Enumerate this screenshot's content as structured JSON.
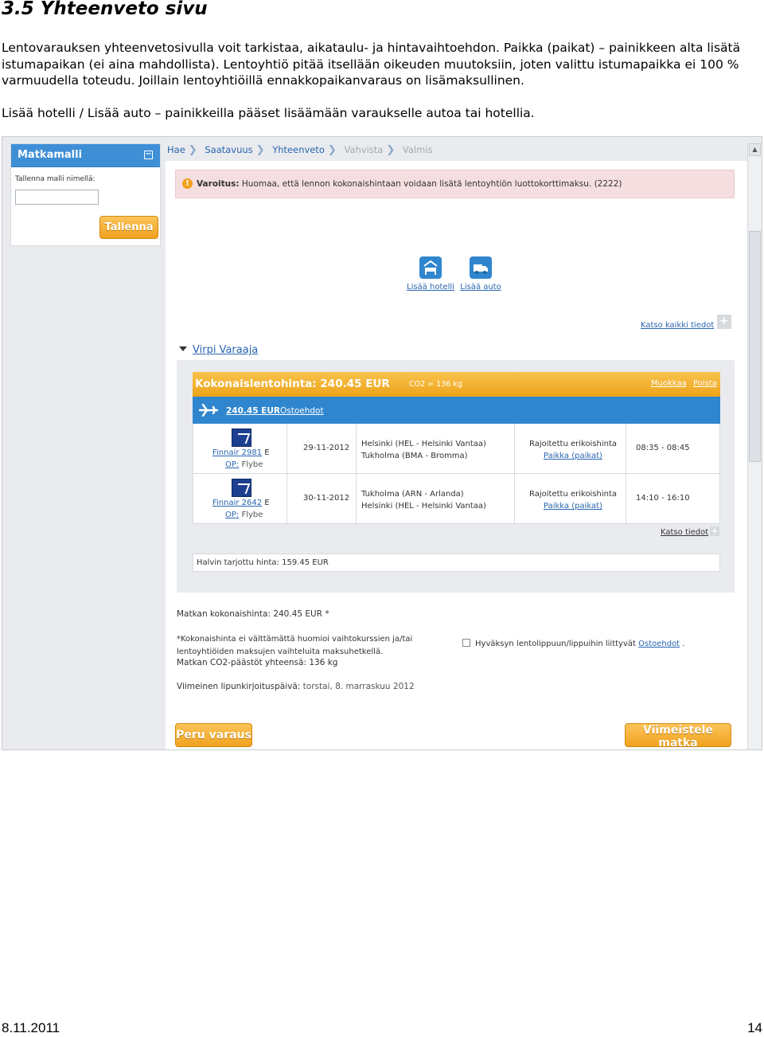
{
  "document": {
    "heading": "3.5 Yhteenveto sivu",
    "paragraph1": "Lentovarauksen yhteenvetosivulla voit tarkistaa, aikataulu- ja hintavaihtoehdon. Paikka (paikat) – painikkeen alta lisätä istumapaikan (ei aina mahdollista). Lentoyhtiö pitää itsellään oikeuden muutoksiin, joten valittu istumapaikka ei 100 % varmuudella toteudu. Joillain lentoyhtiöillä ennakkopaikanvaraus on lisämaksullinen.",
    "paragraph2": "Lisää hotelli / Lisää auto – painikkeilla pääset lisäämään varaukselle autoa tai hotellia.",
    "footer_date": "8.11.2011",
    "footer_page": "14"
  },
  "screenshot": {
    "sidebar": {
      "title": "Matkamalli",
      "minimize_symbol": "−",
      "label": "Tallenna malli nimellä:",
      "input_value": "",
      "save_label": "Tallenna"
    },
    "breadcrumb": {
      "step1": "Hae",
      "step2": "Saatavuus",
      "step3": "Yhteenveto",
      "step4": "Vahvista",
      "step5": "Valmis",
      "separator": "❯"
    },
    "warning": {
      "label": "Varoitus:",
      "text": " Huomaa, että lennon kokonaishintaan voidaan lisätä lentoyhtiön luottokorttimaksu. (2222)"
    },
    "services": {
      "hotel": "Lisää hotelli",
      "car": "Lisää auto"
    },
    "details_all": "Katso kaikki tiedot",
    "traveler": "Virpi Varaaja",
    "trip": {
      "total_label": "Kokonaislentohinta: 240.45 EUR",
      "co2": "CO2 = 136 kg",
      "edit": "Muokkaa",
      "remove": "Poista",
      "price": "240.45 EUR",
      "terms": "Ostoehdot"
    },
    "segments": [
      {
        "flight": "Finnair  2981",
        "class": " E",
        "op_label": "OP:",
        "operator": " Flybe",
        "date": "29-11-2012",
        "from": "Helsinki (HEL - Helsinki Vantaa)",
        "to": "Tukholma (BMA - Bromma)",
        "fare": "Rajoitettu erikoishinta",
        "seat": "Paikka (paikat)",
        "time": "08:35 - 08:45"
      },
      {
        "flight": "Finnair  2642",
        "class": " E",
        "op_label": "OP:",
        "operator": " Flybe",
        "date": "30-11-2012",
        "from": "Tukholma (ARN - Arlanda)",
        "to": "Helsinki (HEL - Helsinki Vantaa)",
        "fare": "Rajoitettu erikoishinta",
        "seat": "Paikka (paikat)",
        "time": "14:10 - 16:10"
      }
    ],
    "segment_details": "Katso tiedot",
    "lowest_price": "Halvin tarjottu hinta: 159.45 EUR",
    "summary": {
      "total": "Matkan kokonaishinta: 240.45 EUR *",
      "note": "*Kokonaishinta ei välttämättä huomioi vaihtokurssien ja/tai\nlentoyhtiöiden maksujen vaihteluita maksuhetkellä.",
      "co2": "Matkan CO2-päästöt yhteensä: 136 kg",
      "deadline_label": "Viimeinen lipunkirjoituspäivä:",
      "deadline_value": "  torstai, 8. marraskuu 2012",
      "accept_text": "Hyväksyn lentolippuun/lippuihin liittyvät ",
      "accept_link": "Ostoehdot",
      "accept_end": " ."
    },
    "buttons": {
      "cancel": "Peru varaus",
      "finish": "Viimeistele matka"
    }
  }
}
